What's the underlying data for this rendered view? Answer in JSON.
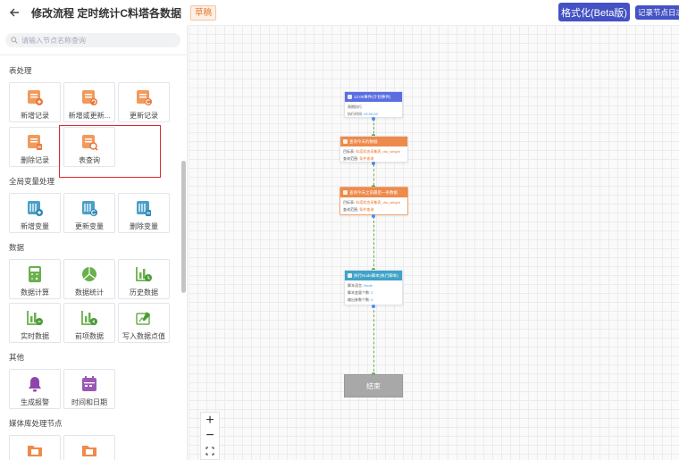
{
  "header": {
    "title": "修改流程 定时统计C料塔各数据",
    "badge": "草稿",
    "format_button": "格式化(Beta版)",
    "log_button": "记录节点日志"
  },
  "sidebar": {
    "search_placeholder": "请输入节点名称查询",
    "sections": [
      {
        "title": "表处理",
        "items": [
          "新增记录",
          "新增或更新...",
          "更新记录",
          "删除记录",
          "表查询"
        ]
      },
      {
        "title": "全局变量处理",
        "items": [
          "新增变量",
          "更新变量",
          "删除变量"
        ]
      },
      {
        "title": "数据",
        "items": [
          "数据计算",
          "数据统计",
          "历史数据",
          "实时数据",
          "前项数据",
          "写入数据点值"
        ]
      },
      {
        "title": "其他",
        "items": [
          "生成报警",
          "时间和日期"
        ]
      },
      {
        "title": "媒体库处理节点",
        "items": []
      }
    ]
  },
  "flow": {
    "trigger": {
      "title": "12:00事件(计划事件)",
      "line1": "周期执行",
      "line2_label": "执行时间:",
      "line2_value": "00:00:00"
    },
    "query1": {
      "title": "查询今天的数据",
      "line1_label": "目标表:",
      "line1_value": "料塔状态采集表_dtu_weight",
      "line2_label": "查询范围:",
      "line2_value": "条件查询"
    },
    "query2": {
      "title": "查询今天之前最后一条数据",
      "line1_label": "目标表:",
      "line1_value": "料塔状态采集表_dtu_weight",
      "line2_label": "查询范围:",
      "line2_value": "条件查询"
    },
    "script": {
      "title": "执行Node脚本(执行脚本)",
      "line1_label": "脚本语言:",
      "line1_value": "Node",
      "line2_label": "脚本变量个数:",
      "line2_value": "2",
      "line3_label": "输出参数个数:",
      "line3_value": "0"
    },
    "end": "结束"
  },
  "zoom": {
    "in": "+",
    "out": "−"
  },
  "colors": {
    "primary": "#4452c4",
    "orange": "#ee8a4b",
    "green": "#6ab04c",
    "purple": "#9b59b6",
    "flow_blue": "#5b6ee0",
    "flow_teal": "#3fa3c8"
  }
}
